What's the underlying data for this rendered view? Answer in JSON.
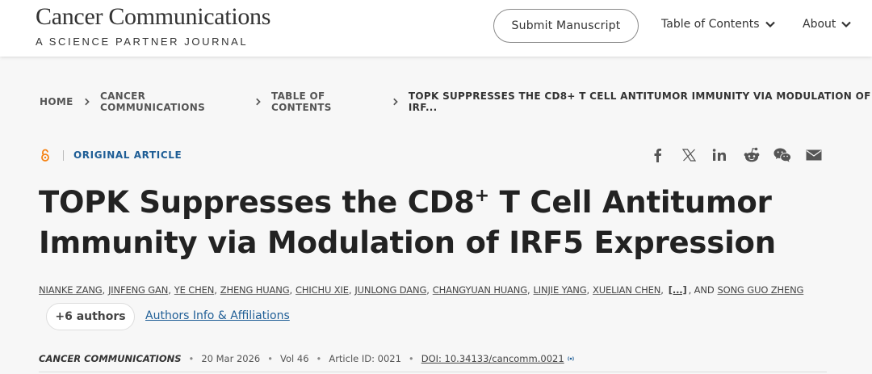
{
  "header": {
    "journal_name": "Cancer Communications",
    "journal_tagline": "A SCIENCE PARTNER JOURNAL",
    "submit_label": "Submit Manuscript",
    "nav": [
      {
        "label": "Table of Contents",
        "icon": "chevron-down-icon"
      },
      {
        "label": "About",
        "icon": "chevron-down-icon"
      }
    ]
  },
  "breadcrumb": [
    "HOME",
    "CANCER COMMUNICATIONS",
    "TABLE OF CONTENTS",
    "TOPK SUPPRESSES THE CD8+ T CELL ANTITUMOR IMMUNITY VIA MODULATION OF IRF..."
  ],
  "article": {
    "access_icon": "open-access-icon",
    "type": "ORIGINAL ARTICLE",
    "title_part1": "TOPK Suppresses the CD8",
    "title_sup": "+",
    "title_part2": " T Cell Antitumor Immunity via Modulation of IRF5 Expression",
    "authors": [
      "NIANKE ZANG",
      "JINFENG GAN",
      "YE CHEN",
      "ZHENG HUANG",
      "CHICHU XIE",
      "JUNLONG DANG",
      "CHANGYUAN HUANG",
      "LINJIE YANG",
      "XUELIAN CHEN"
    ],
    "authors_ellipsis": "[...]",
    "authors_and": ", AND",
    "last_author": "SONG GUO ZHENG",
    "more_authors_label": "+6 authors",
    "affiliations_link": "Authors Info & Affiliations",
    "journal": "CANCER COMMUNICATIONS",
    "date": "20 Mar 2026",
    "volume": "Vol 46",
    "article_id": "Article ID: 0021",
    "doi": "DOI: 10.34133/cancomm.0021"
  },
  "share_icons": [
    "facebook-icon",
    "x-icon",
    "linkedin-icon",
    "reddit-icon",
    "wechat-icon",
    "email-icon"
  ],
  "colors": {
    "accent": "#1f5e96",
    "open_access": "#f68212",
    "band": "#f7f7f7"
  }
}
